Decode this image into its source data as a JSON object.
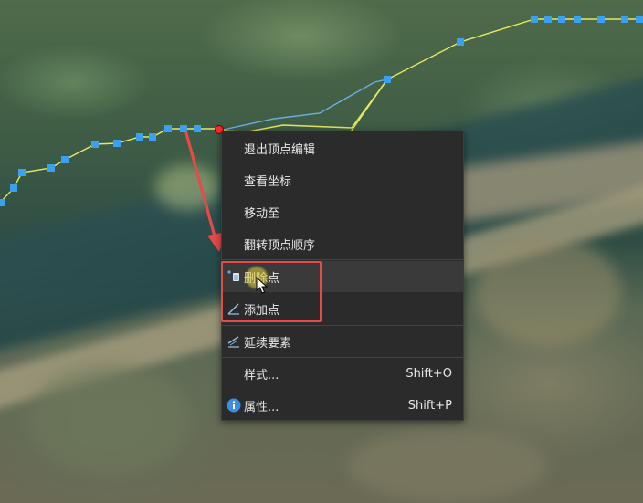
{
  "context_menu": {
    "items": [
      {
        "label": "退出顶点编辑",
        "shortcut": "",
        "icon": ""
      },
      {
        "label": "查看坐标",
        "shortcut": "",
        "icon": ""
      },
      {
        "label": "移动至",
        "shortcut": "",
        "icon": ""
      },
      {
        "label": "翻转顶点顺序",
        "shortcut": "",
        "icon": ""
      },
      {
        "label": "删除点",
        "shortcut": "",
        "icon": "delete-vertex-icon"
      },
      {
        "label": "添加点",
        "shortcut": "",
        "icon": "add-vertex-icon"
      },
      {
        "label": "延续要素",
        "shortcut": "",
        "icon": "continue-feature-icon"
      },
      {
        "label": "样式...",
        "shortcut": "Shift+O",
        "icon": ""
      },
      {
        "label": "属性...",
        "shortcut": "Shift+P",
        "icon": "info-icon"
      }
    ],
    "hovered_item": "删除点"
  },
  "colors": {
    "menu_bg": "#2b2b2b",
    "vertex": "#3aa0f0",
    "line_yellow": "#e6e860",
    "line_blue": "#6ab0e0",
    "annotation_red": "#e84a4a",
    "selected_vertex": "#ff2a2a"
  }
}
